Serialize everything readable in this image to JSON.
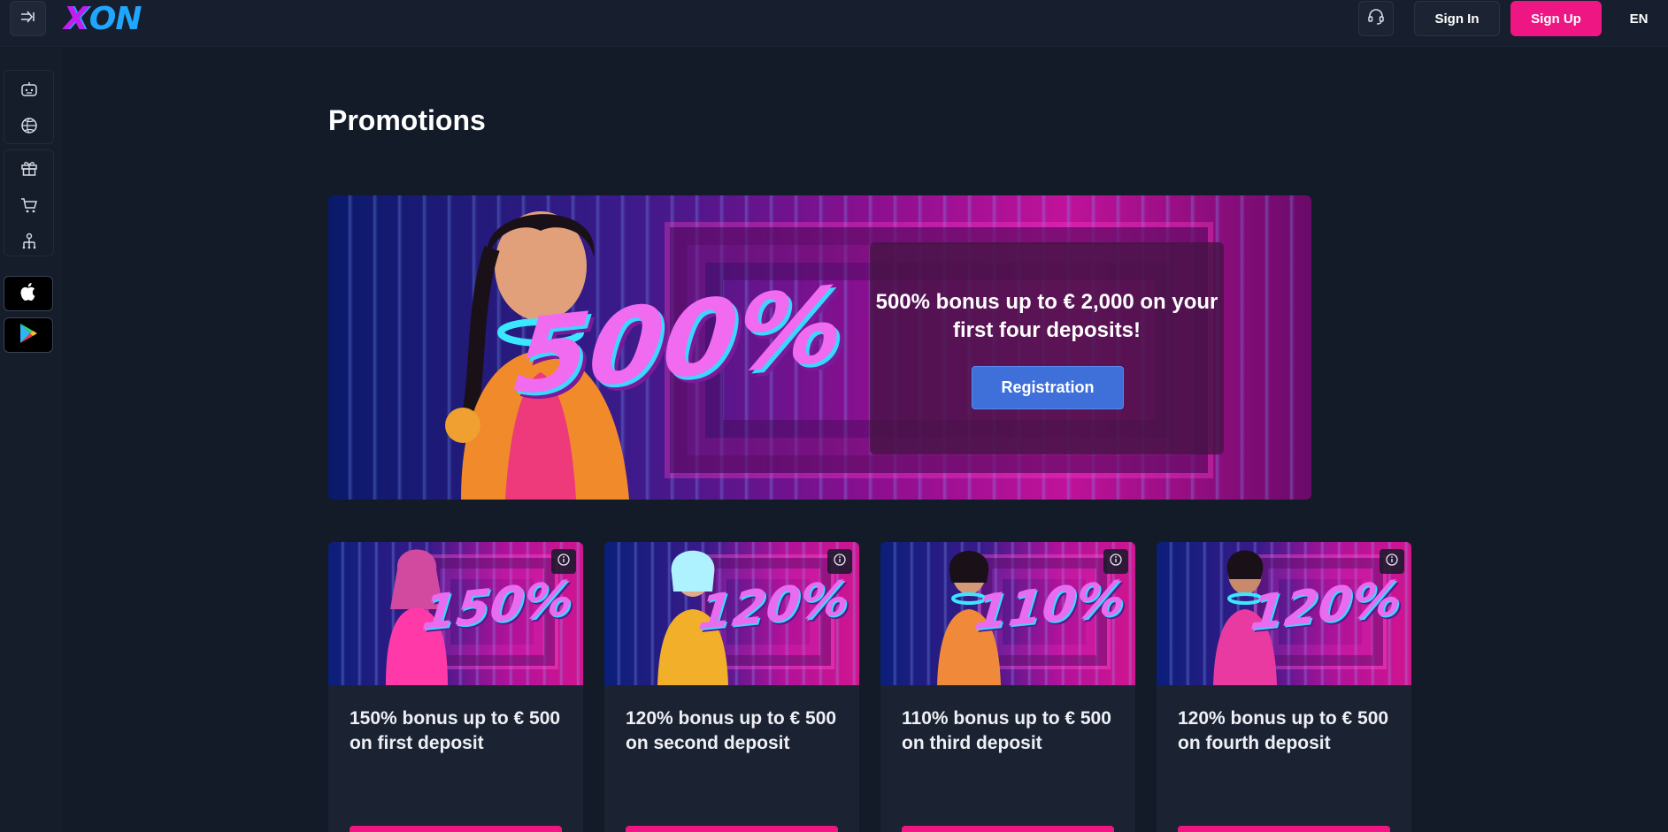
{
  "header": {
    "logo_x": "X",
    "logo_on": "ON",
    "signin_label": "Sign In",
    "signup_label": "Sign Up",
    "language": "EN"
  },
  "sidebar": {
    "icons": [
      "robot-icon",
      "basketball-icon",
      "gift-icon",
      "cart-icon",
      "referral-icon"
    ],
    "apps": [
      "apple-icon",
      "google-play-icon"
    ]
  },
  "main": {
    "title": "Promotions",
    "hero": {
      "badge": "500%",
      "text": "500% bonus up to € 2,000 on your first four deposits!",
      "button_label": "Registration"
    },
    "cards": [
      {
        "badge": "150%",
        "title": "150% bonus up to € 500 on first deposit"
      },
      {
        "badge": "120%",
        "title": "120% bonus up to € 500 on second deposit"
      },
      {
        "badge": "110%",
        "title": "110% bonus up to € 500 on third deposit"
      },
      {
        "badge": "120%",
        "title": "120% bonus up to € 500 on fourth deposit"
      }
    ]
  },
  "colors": {
    "background": "#131a28",
    "accent_pink": "#ee1683",
    "accent_blue": "#3f6fd8"
  }
}
